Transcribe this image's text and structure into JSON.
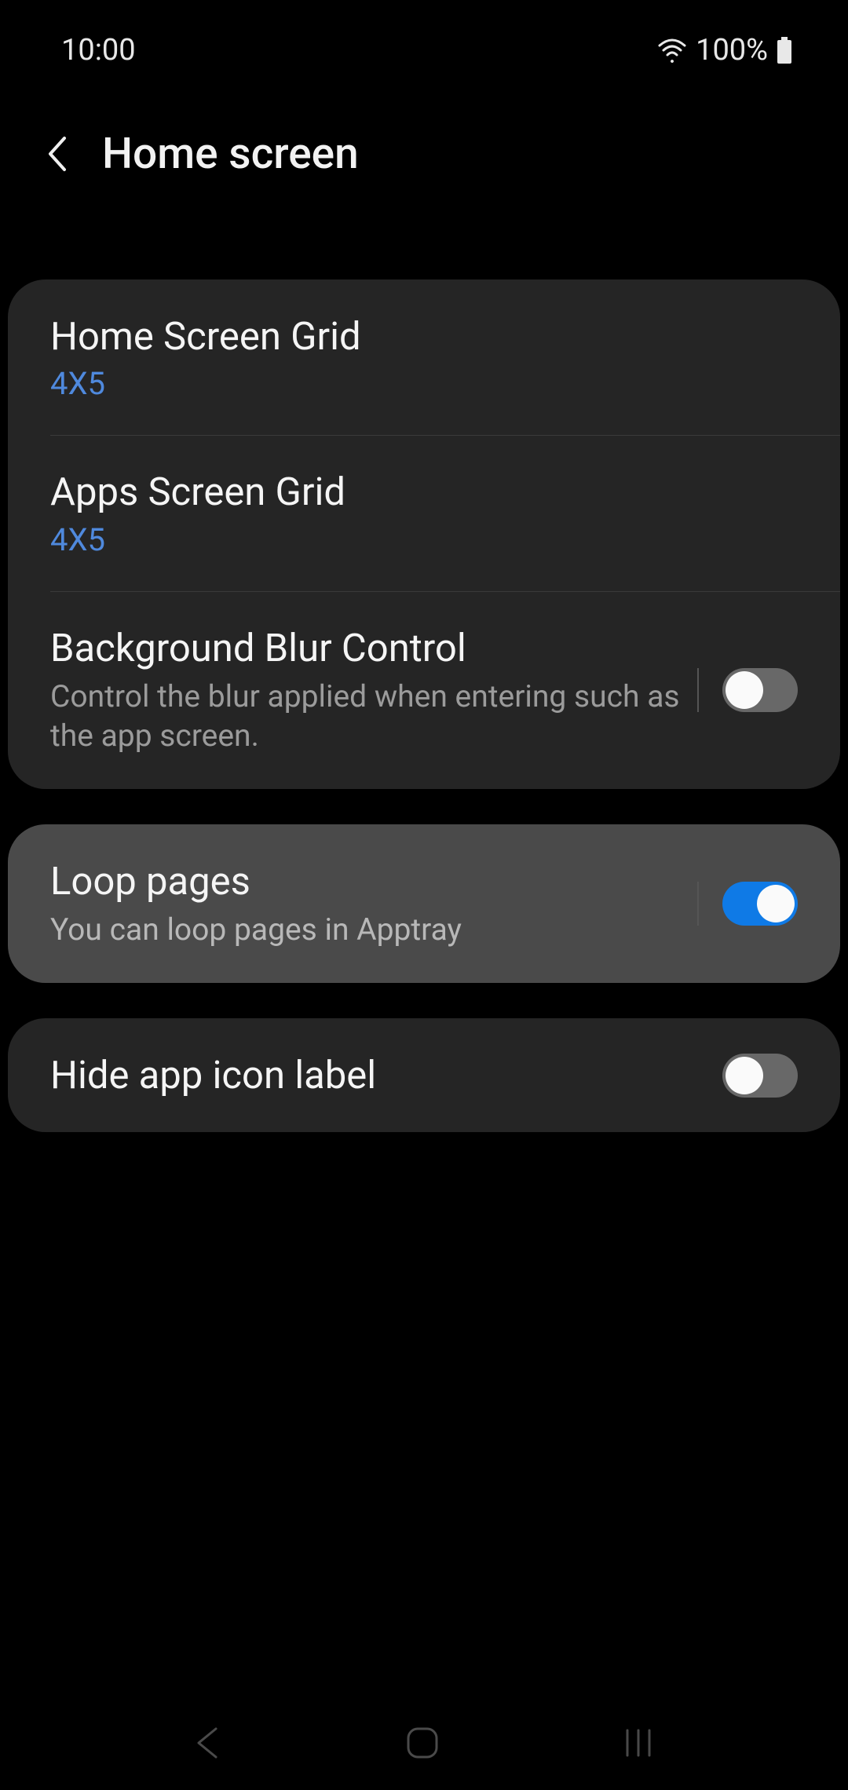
{
  "status": {
    "time": "10:00",
    "battery_text": "100%"
  },
  "header": {
    "title": "Home screen"
  },
  "settings": {
    "home_grid": {
      "title": "Home Screen Grid",
      "value": "4X5"
    },
    "apps_grid": {
      "title": "Apps Screen Grid",
      "value": "4X5"
    },
    "blur": {
      "title": "Background Blur Control",
      "desc": "Control the blur applied when entering such as the app screen.",
      "on": false
    },
    "loop": {
      "title": "Loop pages",
      "desc": "You can loop pages in Apptray",
      "on": true
    },
    "hide_label": {
      "title": "Hide app icon label",
      "on": false
    }
  },
  "colors": {
    "accent": "#4f89dd",
    "toggle_on": "#0f7ae6"
  }
}
